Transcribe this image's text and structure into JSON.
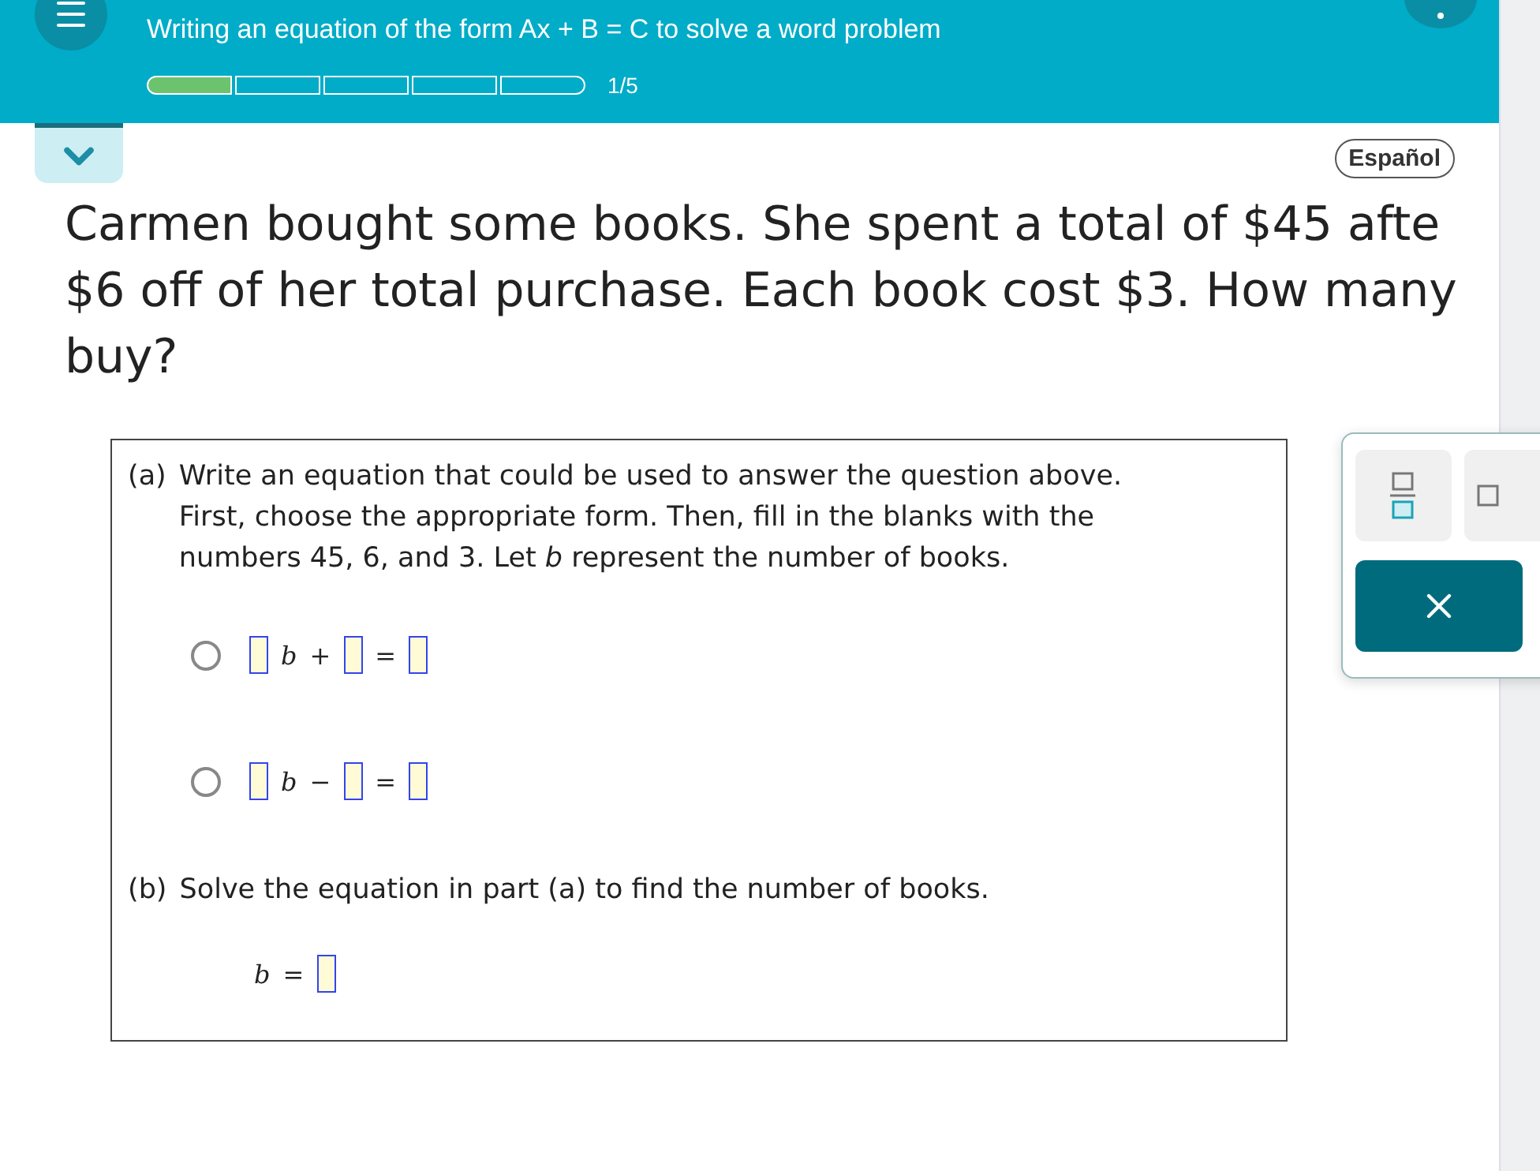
{
  "header": {
    "title": "Writing an equation of the form Ax + B = C to solve a word problem",
    "progress": {
      "segments": [
        {
          "filled": true
        },
        {
          "filled": false
        },
        {
          "filled": false
        },
        {
          "filled": false
        },
        {
          "filled": false
        }
      ],
      "label": "1/5"
    }
  },
  "language_button": "Español",
  "question_lines": [
    "Carmen bought some books. She spent a total of $45 afte",
    "$6 off of her total purchase. Each book cost $3. How many",
    "buy?"
  ],
  "part_a": {
    "label": "(a)",
    "lines": [
      "Write an equation that could be used to answer the question above.",
      "First, choose the appropriate form. Then, fill in the blanks with the",
      "numbers 45, 6, and 3. Let *b* represent the number of books."
    ],
    "options": [
      {
        "selected": false,
        "tokens": [
          {
            "kind": "blank"
          },
          {
            "kind": "var",
            "text": "b"
          },
          {
            "kind": "op",
            "text": "+"
          },
          {
            "kind": "blank"
          },
          {
            "kind": "op",
            "text": "="
          },
          {
            "kind": "blank"
          }
        ]
      },
      {
        "selected": false,
        "tokens": [
          {
            "kind": "blank"
          },
          {
            "kind": "var",
            "text": "b"
          },
          {
            "kind": "op",
            "text": "−"
          },
          {
            "kind": "blank"
          },
          {
            "kind": "op",
            "text": "="
          },
          {
            "kind": "blank"
          }
        ]
      }
    ]
  },
  "part_b": {
    "label": "(b)",
    "text": "Solve the equation in part (a) to find the number of books.",
    "tokens": [
      {
        "kind": "var",
        "text": "b"
      },
      {
        "kind": "op",
        "text": "="
      },
      {
        "kind": "blank"
      }
    ]
  }
}
